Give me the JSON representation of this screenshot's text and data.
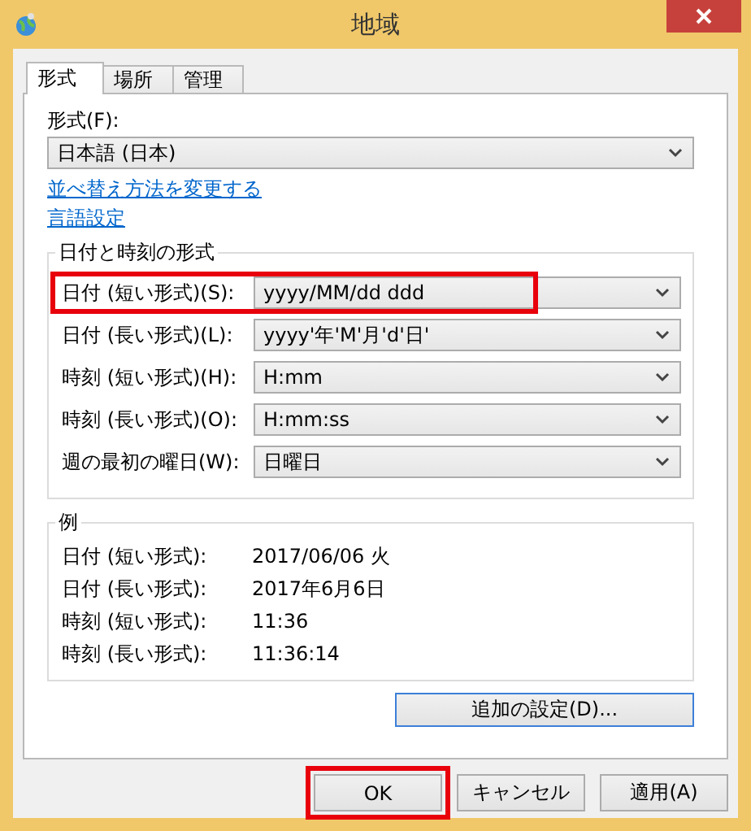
{
  "window": {
    "title": "地域"
  },
  "tabs": [
    {
      "label": "形式",
      "selected": true
    },
    {
      "label": "場所",
      "selected": false
    },
    {
      "label": "管理",
      "selected": false
    }
  ],
  "format": {
    "label": "形式(F):",
    "value": "日本語 (日本)"
  },
  "links": [
    "並べ替え方法を変更する",
    "言語設定"
  ],
  "date_time_formats": {
    "title": "日付と時刻の形式",
    "rows": [
      {
        "label": "日付 (短い形式)(S):",
        "value": "yyyy/MM/dd ddd",
        "highlighted": true
      },
      {
        "label": "日付 (長い形式)(L):",
        "value": "yyyy'年'M'月'd'日'",
        "highlighted": false
      },
      {
        "label": "時刻 (短い形式)(H):",
        "value": "H:mm",
        "highlighted": false
      },
      {
        "label": "時刻 (長い形式)(O):",
        "value": "H:mm:ss",
        "highlighted": false
      },
      {
        "label": "週の最初の曜日(W):",
        "value": "日曜日",
        "highlighted": false
      }
    ]
  },
  "examples": {
    "title": "例",
    "rows": [
      {
        "label": "日付 (短い形式):",
        "value": "2017/06/06 火"
      },
      {
        "label": "日付 (長い形式):",
        "value": "2017年6月6日"
      },
      {
        "label": "時刻 (短い形式):",
        "value": "11:36"
      },
      {
        "label": "時刻 (長い形式):",
        "value": "11:36:14"
      }
    ]
  },
  "additional_settings_button": "追加の設定(D)...",
  "buttons": [
    {
      "label": "OK",
      "highlighted": true
    },
    {
      "label": "キャンセル",
      "highlighted": false
    },
    {
      "label": "適用(A)",
      "highlighted": false
    }
  ]
}
